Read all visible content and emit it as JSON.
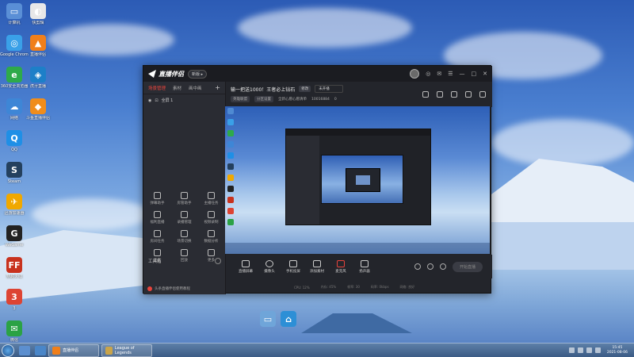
{
  "desktop": {
    "icons_left": [
      {
        "label": "计算机",
        "color": "#5a8fd6",
        "glyph": "▭"
      },
      {
        "label": "Google Chrome",
        "color": "#3aa0e8",
        "glyph": "◎"
      },
      {
        "label": "360安全浏览器",
        "color": "#2eaa4a",
        "glyph": "e"
      },
      {
        "label": "网络",
        "color": "#3e86d6",
        "glyph": "☁"
      },
      {
        "label": "QQ",
        "color": "#1f8fe6",
        "glyph": "Q"
      },
      {
        "label": "Steam",
        "color": "#24405e",
        "glyph": "S"
      },
      {
        "label": "迅游加速器",
        "color": "#f0a800",
        "glyph": "✈"
      },
      {
        "label": "WeGame",
        "color": "#222",
        "glyph": "G"
      },
      {
        "label": "穿越火线",
        "color": "#c8321e",
        "glyph": "FF"
      },
      {
        "label": "3",
        "color": "#d43",
        "glyph": "3"
      },
      {
        "label": "微信",
        "color": "#2ba245",
        "glyph": "✉"
      }
    ],
    "icons_col2": [
      {
        "label": "快剪辑",
        "color": "#e8e8e8",
        "glyph": "◐"
      },
      {
        "label": "直播伴侣",
        "color": "#f07f1a",
        "glyph": "▲"
      },
      {
        "label": "虎牙直播",
        "color": "#1d7fc8",
        "glyph": "◈"
      },
      {
        "label": "斗鱼直播伴侣",
        "color": "#f08d1b",
        "glyph": "◆"
      }
    ]
  },
  "app": {
    "logo_text": "直播伴侣",
    "version_badge": "新版 ▸",
    "window_controls": [
      "☺",
      "◎",
      "✉",
      "☰",
      "—",
      "□",
      "✕"
    ],
    "left_tabs": [
      "场景管理",
      "素材",
      "画中画"
    ],
    "left_add": "+",
    "scene_item": "全屏 1",
    "tools_title": "工具箱",
    "tools": [
      {
        "label": "弹幕助手"
      },
      {
        "label": "房管助手"
      },
      {
        "label": "主播任务"
      },
      {
        "label": "福利直播"
      },
      {
        "label": "录播管理"
      },
      {
        "label": "视频录制"
      },
      {
        "label": "房间任务"
      },
      {
        "label": "场景切换"
      },
      {
        "label": "数据分析"
      },
      {
        "label": "连麦"
      },
      {
        "label": "回放"
      },
      {
        "label": "更多"
      }
    ],
    "left_footer": "头条直播伴侣使用教程",
    "room_title": "输一把送1000！王者必上钻石",
    "room_tag": "修改",
    "room_field": "未开播",
    "room_info": [
      "英雄联盟",
      "分区设置",
      "全新心愿心愿清单",
      "10016884",
      "0"
    ],
    "bottom_buttons": [
      {
        "label": "直播屏幕"
      },
      {
        "label": "摄像头"
      },
      {
        "label": "手机投屏"
      },
      {
        "label": "添加素材"
      },
      {
        "label": "麦克风"
      },
      {
        "label": "扬声器"
      }
    ],
    "start_live": "开始直播",
    "status_items": [
      "CPU: 12%",
      "内存: 45%",
      "帧率: 30",
      "码率: 0kbps",
      "网络: 良好"
    ]
  },
  "taskbar": {
    "tasks": [
      {
        "label": "直播伴侣",
        "color": "#f07f1a"
      },
      {
        "label": "League of Legends",
        "color": "#c9a44a"
      }
    ],
    "clock_time": "15:45",
    "clock_date": "2021-08-06"
  }
}
